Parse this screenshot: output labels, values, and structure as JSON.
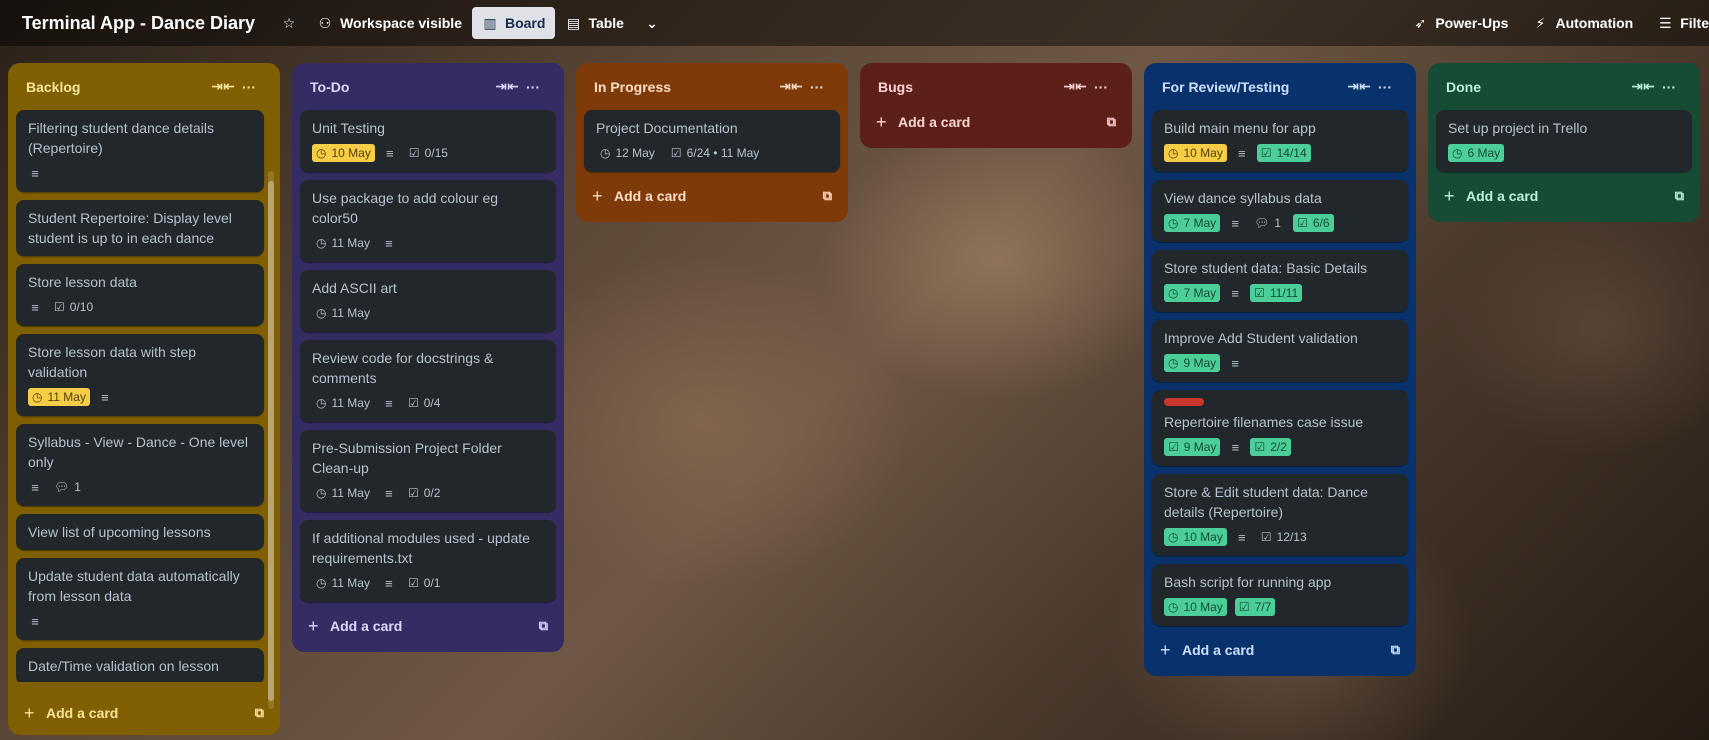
{
  "board": {
    "title": "Terminal App - Dance Diary",
    "star_icon": "star-icon",
    "visibility_label": "Workspace visible",
    "views": [
      {
        "label": "Board",
        "icon": "board-icon",
        "active": true
      },
      {
        "label": "Table",
        "icon": "table-icon",
        "active": false
      }
    ],
    "powerups_label": "Power-Ups",
    "automation_label": "Automation",
    "filters_label": "Filte"
  },
  "lists": {
    "backlog": {
      "title": "Backlog",
      "add_label": "Add a card",
      "cards": [
        {
          "title": "Filtering student dance details (Repertoire)",
          "desc": true
        },
        {
          "title": "Student Repertoire: Display level student is up to in each dance"
        },
        {
          "title": "Store lesson data",
          "desc": true,
          "checklist": "0/10"
        },
        {
          "title": "Store lesson data with step validation",
          "due": "11 May",
          "desc": true
        },
        {
          "title": "Syllabus - View - Dance - One level only",
          "desc": true,
          "comments": "1"
        },
        {
          "title": "View list of upcoming lessons"
        },
        {
          "title": "Update student data automatically from lesson data",
          "desc": true
        },
        {
          "title": "Date/Time validation on lesson"
        }
      ]
    },
    "todo": {
      "title": "To-Do",
      "add_label": "Add a card",
      "cards": [
        {
          "title": "Unit Testing",
          "due": "10 May",
          "desc": true,
          "checklist": "0/15"
        },
        {
          "title": "Use package to add colour eg color50",
          "date": "11 May",
          "desc": true
        },
        {
          "title": "Add ASCII art",
          "date": "11 May"
        },
        {
          "title": "Review code for docstrings & comments",
          "date": "11 May",
          "desc": true,
          "checklist": "0/4"
        },
        {
          "title": "Pre-Submission Project Folder Clean-up",
          "date": "11 May",
          "desc": true,
          "checklist": "0/2"
        },
        {
          "title": "If additional modules used - update requirements.txt",
          "date": "11 May",
          "desc": true,
          "checklist": "0/1"
        }
      ]
    },
    "inprogress": {
      "title": "In Progress",
      "add_label": "Add a card",
      "cards": [
        {
          "title": "Project Documentation",
          "date": "12 May",
          "checklist": "6/24 • 11 May"
        }
      ]
    },
    "bugs": {
      "title": "Bugs",
      "add_label": "Add a card"
    },
    "review": {
      "title": "For Review/Testing",
      "add_label": "Add a card",
      "cards": [
        {
          "title": "Build main menu for app",
          "due": "10 May",
          "desc": true,
          "checklist": "14/14"
        },
        {
          "title": "View dance syllabus data",
          "done": "7 May",
          "desc": true,
          "comments": "1",
          "checklist": "6/6"
        },
        {
          "title": "Store student data: Basic Details",
          "done": "7 May",
          "desc": true,
          "checklist": "11/11"
        },
        {
          "title": "Improve Add Student validation",
          "done": "9 May",
          "desc": true
        },
        {
          "title": "Repertoire filenames case issue",
          "label": "red",
          "done": "9 May",
          "desc": true,
          "checklist": "2/2"
        },
        {
          "title": "Store & Edit student data: Dance details (Repertoire)",
          "done": "10 May",
          "desc": true,
          "checklist": "12/13"
        },
        {
          "title": "Bash script for running app",
          "done": "10 May",
          "checklist": "7/7"
        }
      ]
    },
    "done": {
      "title": "Done",
      "add_label": "Add a card",
      "cards": [
        {
          "title": "Set up project in Trello",
          "done": "6 May"
        }
      ]
    }
  },
  "colors": {
    "backlog": "#7f5f01",
    "todo": "#352c63",
    "inprogress": "#7f3a0a",
    "bugs": "#5d1f1a",
    "review": "#09326c",
    "done": "#164b35",
    "due_yellow": "#f5cd47",
    "complete_green": "#4bce97",
    "label_red": "#c9372c"
  }
}
